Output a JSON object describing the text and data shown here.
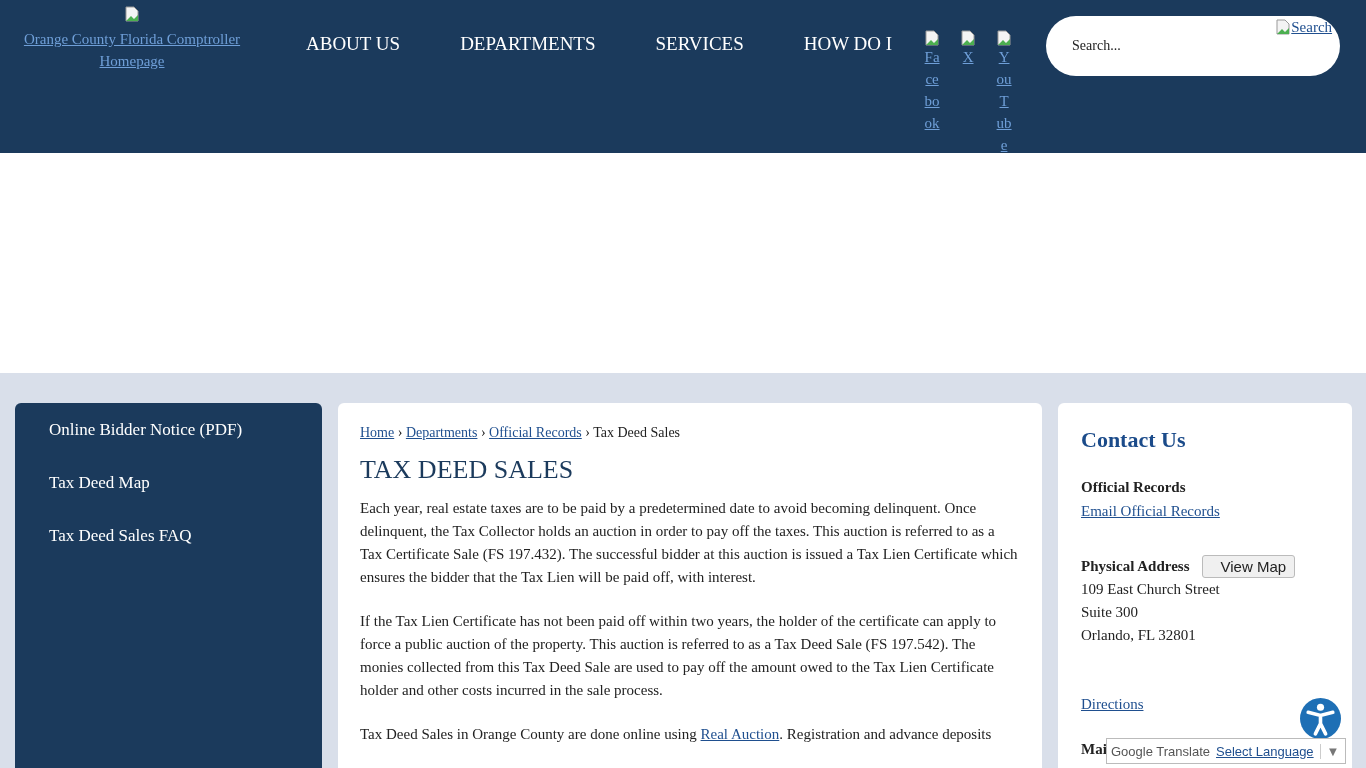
{
  "header": {
    "logo_alt": "Orange County Florida Comptroller Homepage",
    "nav": [
      "ABOUT US",
      "DEPARTMENTS",
      "SERVICES",
      "HOW DO I"
    ],
    "social": [
      "Facebook",
      "X",
      "YouTube"
    ],
    "search": {
      "placeholder": "Search...",
      "button_alt": "Search"
    }
  },
  "sidebar": {
    "items": [
      "Online Bidder Notice (PDF)",
      "Tax Deed Map",
      "Tax Deed Sales FAQ"
    ]
  },
  "breadcrumb": {
    "links": [
      "Home",
      "Departments",
      "Official Records"
    ],
    "current": "Tax Deed Sales",
    "separator": "›"
  },
  "page": {
    "title": "TAX DEED SALES",
    "paragraphs": [
      {
        "text": "Each year, real estate taxes are to be paid by a predetermined date to avoid becoming delinquent. Once delinquent, the Tax Collector holds an auction in order to pay off the taxes. This auction is referred to as a Tax Certificate Sale (FS 197.432). The successful bidder at this auction is issued a Tax Lien Certificate which ensures the bidder that the Tax Lien will be paid off, with interest."
      },
      {
        "text": "If the Tax Lien Certificate has not been paid off within two years, the holder of the certificate can apply to force a public auction of the property. This auction is referred to as a Tax Deed Sale (FS 197.542). The monies collected from this Tax Deed Sale are used to pay off the amount owed to the Tax Lien Certificate holder and other costs incurred in the sale process."
      },
      {
        "before": "Tax Deed Sales in Orange County are done online using ",
        "link": "Real Auction",
        "after": ". Registration and advance deposits"
      }
    ]
  },
  "contact": {
    "title": "Contact Us",
    "department": "Official Records",
    "email_link": "Email Official Records",
    "address_label": "Physical Address",
    "map_button": "View Map",
    "address_lines": [
      "109 East Church Street",
      "Suite 300",
      "Orlando, FL 32801"
    ],
    "directions_link": "Directions",
    "next_label": "Mai"
  },
  "translate": {
    "label": "Google Translate",
    "link": "Select Language",
    "caret": "▼"
  }
}
